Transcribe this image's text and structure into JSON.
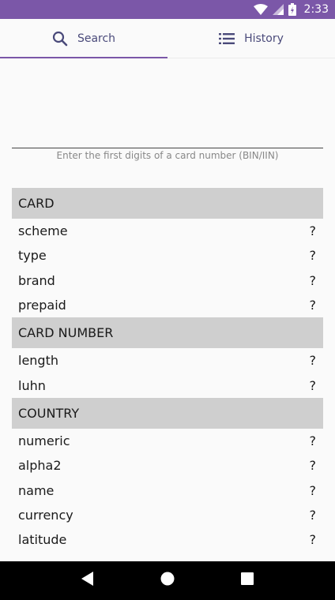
{
  "status_bar": {
    "time": "2:33"
  },
  "tabs": [
    {
      "label": "Search",
      "icon": "search-icon",
      "active": true
    },
    {
      "label": "History",
      "icon": "list-icon",
      "active": false
    }
  ],
  "search": {
    "value": "",
    "hint": "Enter the first digits of a card number (BIN/IIN)"
  },
  "sections": {
    "card": {
      "title": "CARD",
      "rows": [
        {
          "label": "scheme",
          "value": "?"
        },
        {
          "label": "type",
          "value": "?"
        },
        {
          "label": "brand",
          "value": "?"
        },
        {
          "label": "prepaid",
          "value": "?"
        }
      ]
    },
    "card_number": {
      "title": "CARD NUMBER",
      "rows": [
        {
          "label": "length",
          "value": "?"
        },
        {
          "label": "luhn",
          "value": "?"
        }
      ]
    },
    "country": {
      "title": "COUNTRY",
      "rows": [
        {
          "label": "numeric",
          "value": "?"
        },
        {
          "label": "alpha2",
          "value": "?"
        },
        {
          "label": "name",
          "value": "?"
        },
        {
          "label": "currency",
          "value": "?"
        },
        {
          "label": "latitude",
          "value": "?"
        }
      ]
    }
  },
  "colors": {
    "primary": "#7b57a8",
    "section_bg": "#cfcfcf"
  }
}
